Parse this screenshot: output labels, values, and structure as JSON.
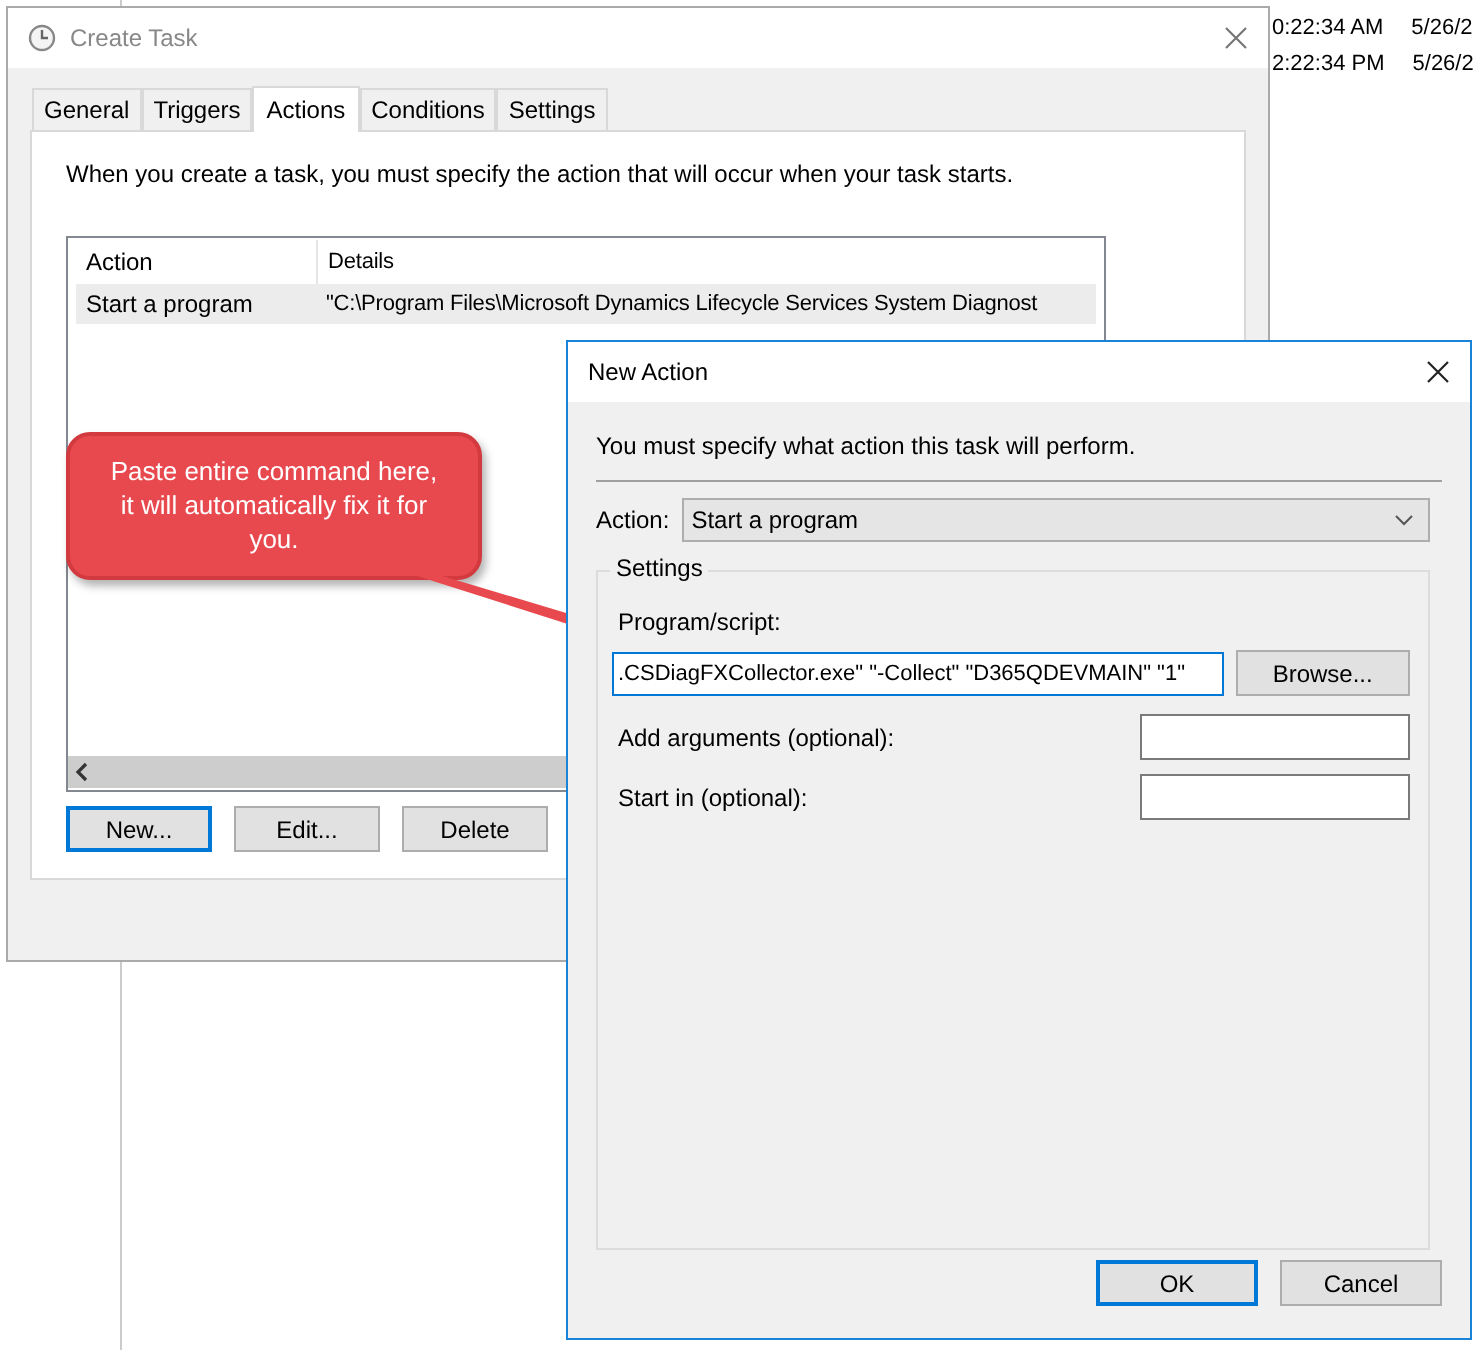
{
  "background_window": {
    "rows": [
      {
        "time": "0:22:34 AM",
        "date": "5/26/2"
      },
      {
        "time": "2:22:34 PM",
        "date": "5/26/2"
      }
    ]
  },
  "create_task": {
    "title": "Create Task",
    "tabs": [
      {
        "label": "General",
        "selected": false
      },
      {
        "label": "Triggers",
        "selected": false
      },
      {
        "label": "Actions",
        "selected": true
      },
      {
        "label": "Conditions",
        "selected": false
      },
      {
        "label": "Settings",
        "selected": false
      }
    ],
    "description": "When you create a task, you must specify the action that will occur when your task starts.",
    "table": {
      "columns": [
        "Action",
        "Details"
      ],
      "rows": [
        {
          "cells": [
            "Start a program",
            "\"C:\\Program Files\\Microsoft Dynamics Lifecycle Services System Diagnost"
          ],
          "selected": true
        }
      ]
    },
    "buttons": [
      {
        "label": "New...",
        "focused": true
      },
      {
        "label": "Edit...",
        "focused": false
      },
      {
        "label": "Delete",
        "focused": false
      }
    ]
  },
  "callout": {
    "text": "Paste entire command here, it will automatically fix it for you."
  },
  "new_action": {
    "title": "New Action",
    "description": "You must specify what action this task will perform.",
    "action": {
      "label": "Action:",
      "value": "Start a program"
    },
    "settings": {
      "title": "Settings",
      "fields": [
        {
          "label": "Program/script:",
          "value": ".CSDiagFXCollector.exe\" \"-Collect\" \"D365QDEVMAIN\" \"1\"",
          "focused": true,
          "kind": "stacked"
        },
        {
          "label": "Add arguments (optional):",
          "focused": false,
          "kind": "inline"
        },
        {
          "label": "Start in (optional):",
          "focused": false,
          "kind": "inline"
        }
      ],
      "browse": "Browse..."
    },
    "buttons": [
      {
        "label": "OK",
        "focused": true
      },
      {
        "label": "Cancel",
        "focused": false
      }
    ]
  }
}
